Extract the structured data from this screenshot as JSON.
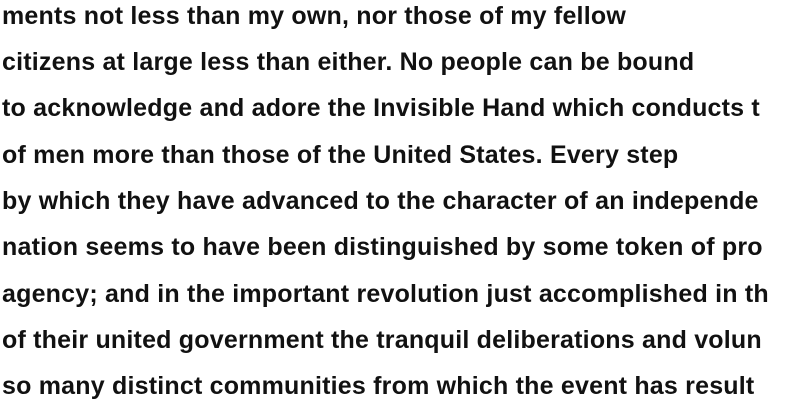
{
  "document": {
    "lines": [
      "ments not less than my own, nor those of my fellow",
      "citizens at large less than either. No people can be bound",
      "to acknowledge and adore the Invisible Hand which conducts t",
      "of men more than those of the United States. Every step",
      "by which they have advanced to the character of an independe",
      "nation seems to have been distinguished by some token of pro",
      "agency; and in the important revolution just accomplished in th",
      "of their united government the tranquil deliberations and volun",
      "so many distinct communities from which the event has result"
    ]
  }
}
